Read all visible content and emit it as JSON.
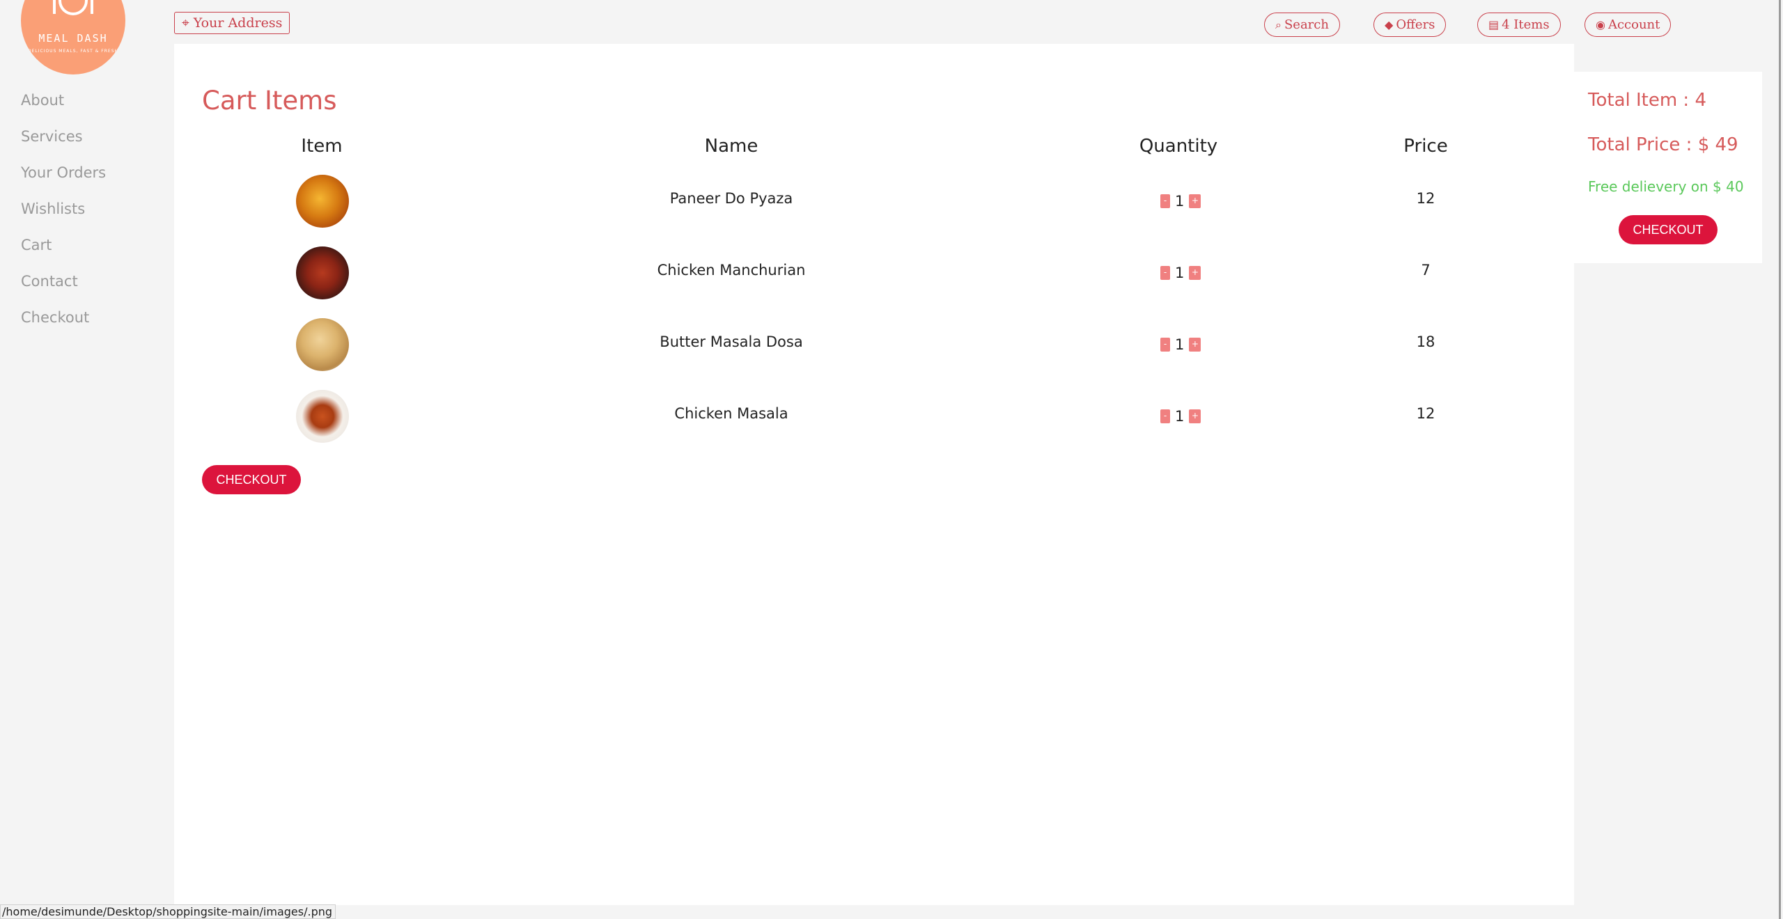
{
  "logo": {
    "text": "MEAL DASH",
    "tagline": "DELICIOUS MEALS, FAST & FRESH"
  },
  "sidebar": {
    "items": [
      {
        "label": "About"
      },
      {
        "label": "Services"
      },
      {
        "label": "Your Orders"
      },
      {
        "label": "Wishlists"
      },
      {
        "label": "Cart"
      },
      {
        "label": "Contact"
      },
      {
        "label": "Checkout"
      }
    ]
  },
  "header": {
    "address_label": "Your Address",
    "search_label": "Search",
    "offers_label": "Offers",
    "cart_label": "4 Items",
    "account_label": "Account",
    "accent_color": "#c9404b"
  },
  "cart": {
    "title": "Cart Items",
    "columns": [
      "Item",
      "Name",
      "Quantity",
      "Price"
    ],
    "rows": [
      {
        "name": "Paneer Do Pyaza",
        "quantity": "1",
        "price": "12",
        "image": "paneer-do-pyaza-image"
      },
      {
        "name": "Chicken Manchurian",
        "quantity": "1",
        "price": "7",
        "image": "chicken-manchurian-image"
      },
      {
        "name": "Butter Masala Dosa",
        "quantity": "1",
        "price": "18",
        "image": "butter-masala-dosa-image"
      },
      {
        "name": "Chicken Masala",
        "quantity": "1",
        "price": "12",
        "image": "chicken-masala-image"
      }
    ],
    "minus_label": "-",
    "plus_label": "+",
    "checkout_label": "CHECKOUT"
  },
  "summary": {
    "total_items": "Total Item : 4",
    "total_price": "Total Price : $ 49",
    "free_delivery": "Free delievery on $ 40",
    "checkout_label": "CHECKOUT"
  },
  "status_bar": {
    "url": "/home/desimunde/Desktop/shoppingsite-main/images/.png"
  },
  "colors": {
    "primary": "#dc143c",
    "title": "#d65a5a",
    "free_delivery": "#5ac85a",
    "logo_bg": "#fa9f76"
  }
}
